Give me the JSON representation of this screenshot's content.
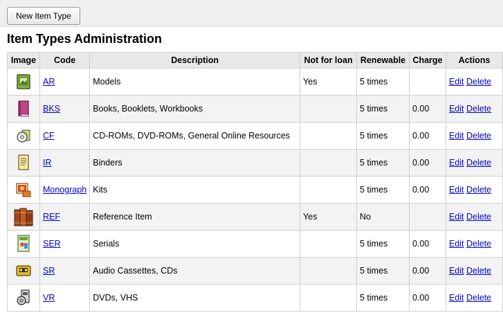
{
  "toolbar": {
    "new_item_type_label": "New Item Type"
  },
  "page_title": "Item Types Administration",
  "table": {
    "headers": [
      "Image",
      "Code",
      "Description",
      "Not for loan",
      "Renewable",
      "Charge",
      "Actions"
    ],
    "edit_label": "Edit",
    "delete_label": "Delete",
    "rows": [
      {
        "icon": "picture-frame-icon",
        "code": "AR",
        "description": "Models",
        "not_for_loan": "Yes",
        "renewable": "5 times",
        "charge": ""
      },
      {
        "icon": "book-icon",
        "code": "BKS",
        "description": "Books, Booklets, Workbooks",
        "not_for_loan": "",
        "renewable": "5 times",
        "charge": "0.00"
      },
      {
        "icon": "cd-icon",
        "code": "CF",
        "description": "CD-ROMs, DVD-ROMs, General Online Resources",
        "not_for_loan": "",
        "renewable": "5 times",
        "charge": "0.00"
      },
      {
        "icon": "document-icon",
        "code": "IR",
        "description": "Binders",
        "not_for_loan": "",
        "renewable": "5 times",
        "charge": "0.00"
      },
      {
        "icon": "kit-icon",
        "code": "Monograph",
        "description": "Kits",
        "not_for_loan": "",
        "renewable": "5 times",
        "charge": "0.00"
      },
      {
        "icon": "reference-books-icon",
        "code": "REF",
        "description": "Reference Item",
        "not_for_loan": "Yes",
        "renewable": "No",
        "charge": ""
      },
      {
        "icon": "serial-icon",
        "code": "SER",
        "description": "Serials",
        "not_for_loan": "",
        "renewable": "5 times",
        "charge": "0.00"
      },
      {
        "icon": "cassette-icon",
        "code": "SR",
        "description": "Audio Cassettes, CDs",
        "not_for_loan": "",
        "renewable": "5 times",
        "charge": "0.00"
      },
      {
        "icon": "video-icon",
        "code": "VR",
        "description": "DVDs, VHS",
        "not_for_loan": "",
        "renewable": "5 times",
        "charge": "0.00"
      }
    ]
  }
}
